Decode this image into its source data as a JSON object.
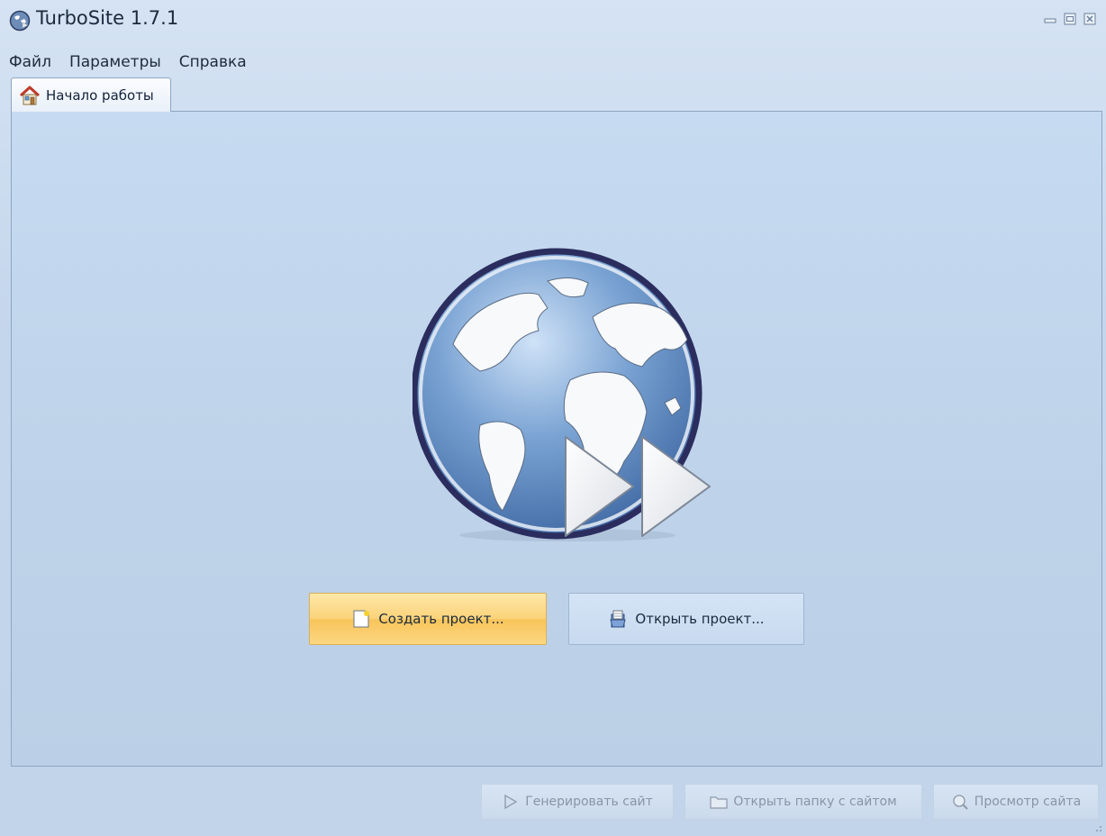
{
  "window": {
    "title": "TurboSite 1.7.1"
  },
  "menu": {
    "items": [
      "Файл",
      "Параметры",
      "Справка"
    ]
  },
  "tabs": [
    {
      "label": "Начало работы",
      "icon": "home-icon",
      "active": true
    }
  ],
  "start_page": {
    "create_button": {
      "label": "Создать проект...",
      "icon": "new-document-icon"
    },
    "open_button": {
      "label": "Открыть проект...",
      "icon": "open-project-icon"
    }
  },
  "actions": {
    "generate": {
      "label": "Генерировать сайт",
      "icon": "play-icon",
      "enabled": false
    },
    "open_folder": {
      "label": "Открыть папку с сайтом",
      "icon": "folder-icon",
      "enabled": false
    },
    "preview": {
      "label": "Просмотр сайта",
      "icon": "magnifier-icon",
      "enabled": false
    }
  },
  "colors": {
    "highlight_button": "#fbd37a",
    "background": "#c6dbf1",
    "globe_outline": "#2b2d5e"
  }
}
